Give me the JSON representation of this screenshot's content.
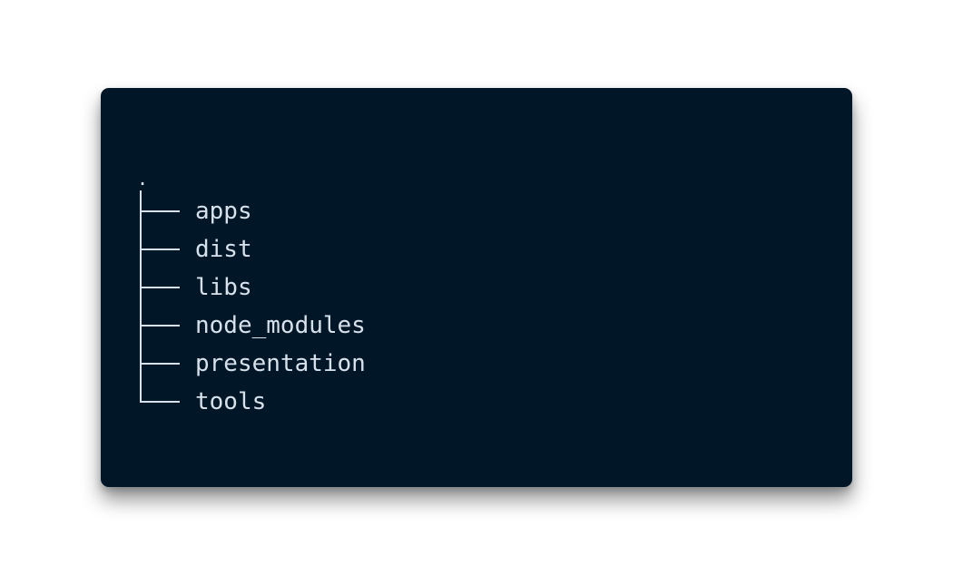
{
  "colors": {
    "page_background": "#ffffff",
    "panel_background": "#011627",
    "text": "#d7e1ec",
    "tree_lines": "#d7e1ec"
  },
  "tree": {
    "root": ".",
    "items": [
      {
        "name": "apps"
      },
      {
        "name": "dist"
      },
      {
        "name": "libs"
      },
      {
        "name": "node_modules"
      },
      {
        "name": "presentation"
      },
      {
        "name": "tools"
      }
    ]
  }
}
